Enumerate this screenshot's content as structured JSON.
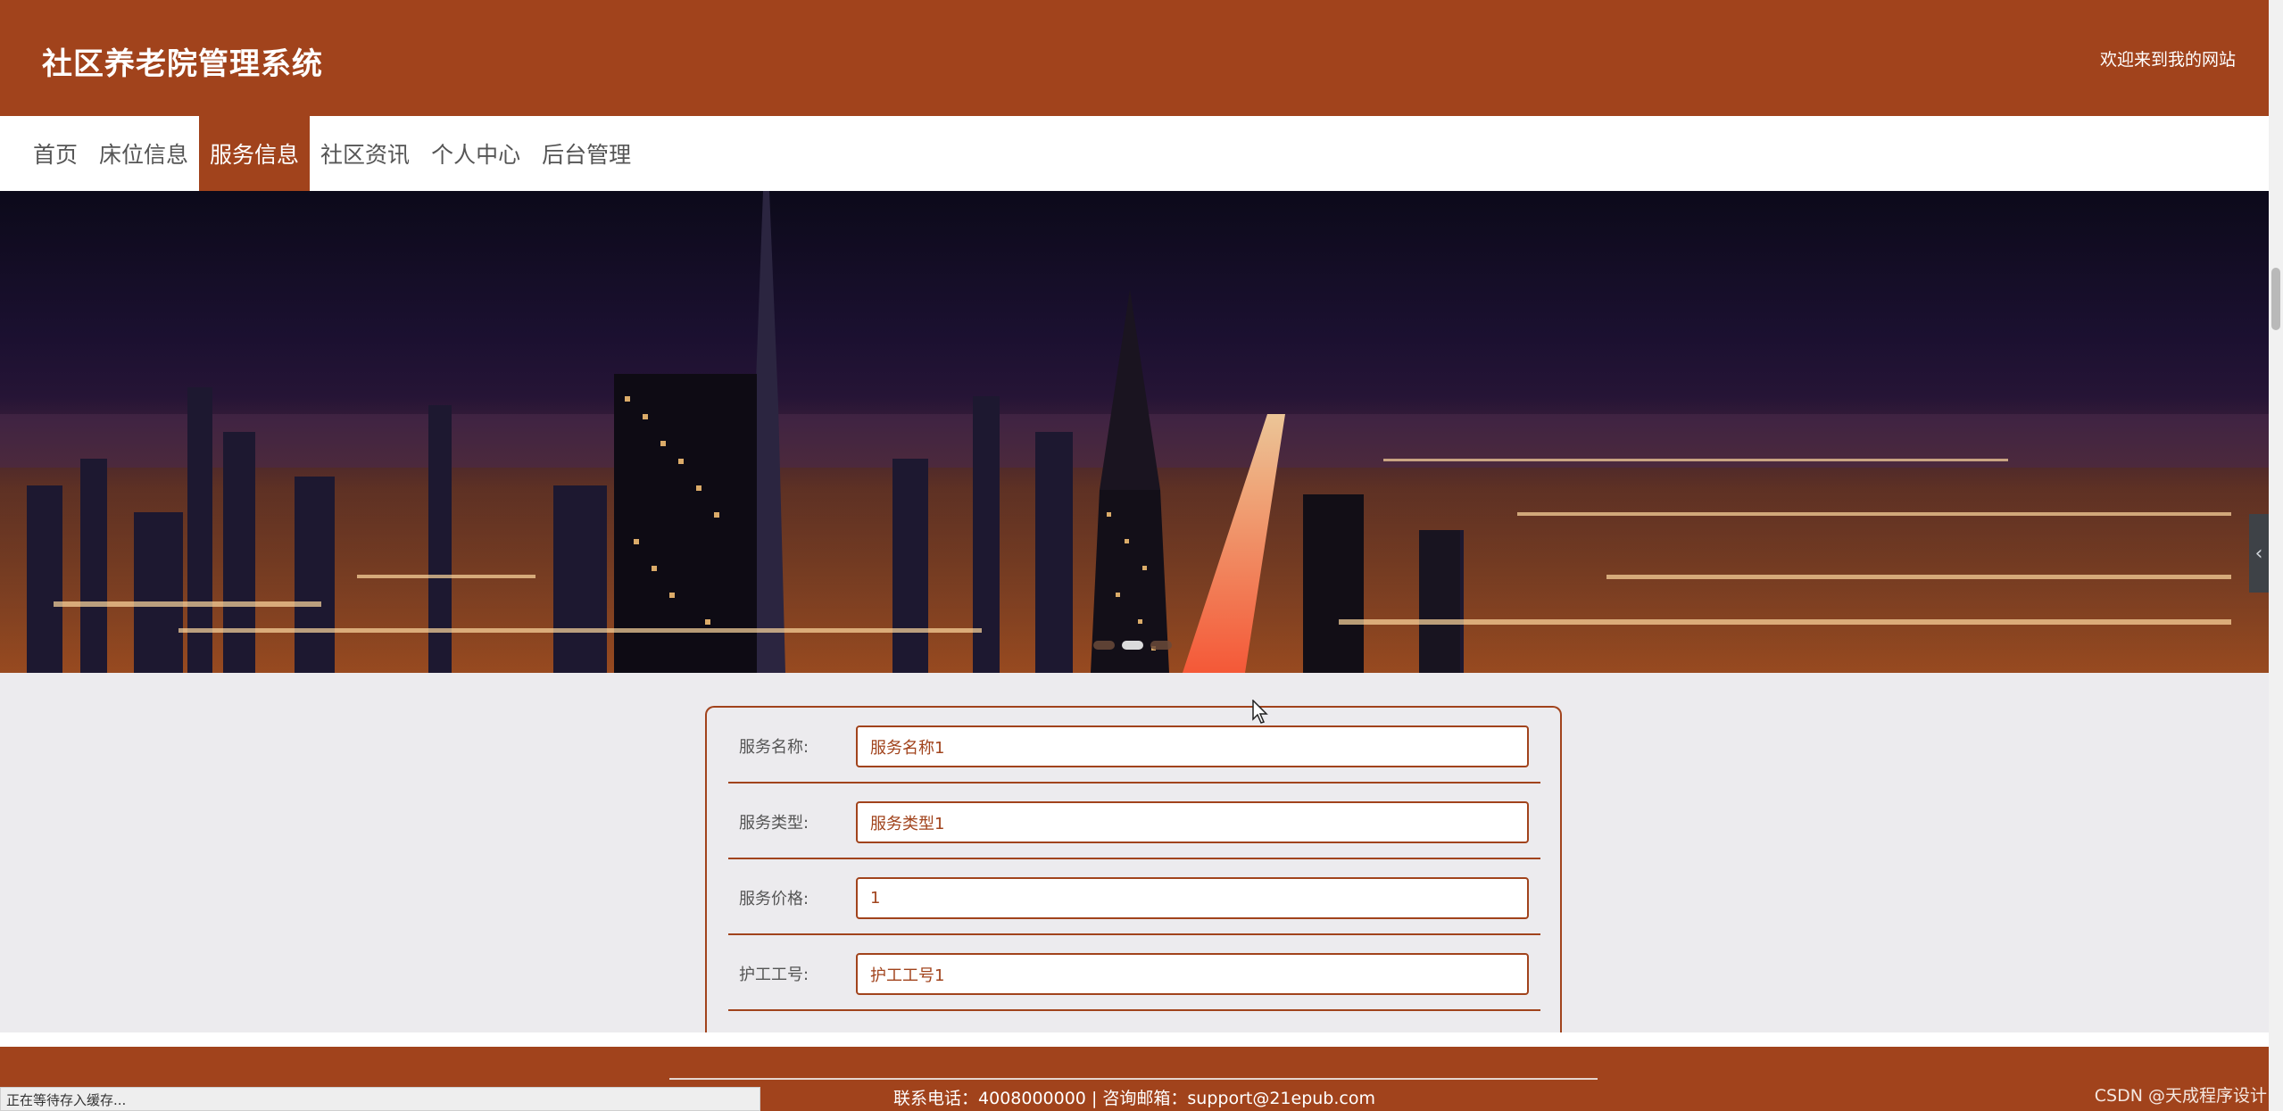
{
  "header": {
    "title": "社区养老院管理系统",
    "welcome": "欢迎来到我的网站"
  },
  "nav": {
    "items": [
      {
        "label": "首页",
        "active": false
      },
      {
        "label": "床位信息",
        "active": false
      },
      {
        "label": "服务信息",
        "active": true
      },
      {
        "label": "社区资讯",
        "active": false
      },
      {
        "label": "个人中心",
        "active": false
      },
      {
        "label": "后台管理",
        "active": false
      }
    ]
  },
  "banner": {
    "slide_count": 3,
    "active_slide": 2
  },
  "form": {
    "fields": [
      {
        "label": "服务名称:",
        "value": "服务名称1"
      },
      {
        "label": "服务类型:",
        "value": "服务类型1"
      },
      {
        "label": "服务价格:",
        "value": "1"
      },
      {
        "label": "护工工号:",
        "value": "护工工号1"
      }
    ]
  },
  "footer": {
    "contact": "联系电话：4008000000 | 咨询邮箱：support@21epub.com"
  },
  "browser": {
    "status": "正在等待存入缓存..."
  },
  "watermark": "CSDN @天成程序设计",
  "colors": {
    "brand": "#a1431c",
    "page_bg": "#ecebee",
    "nav_bg": "#ffffff"
  },
  "icons": {
    "side_tab": "chevron-left-icon",
    "cursor": "mouse-pointer-icon"
  }
}
